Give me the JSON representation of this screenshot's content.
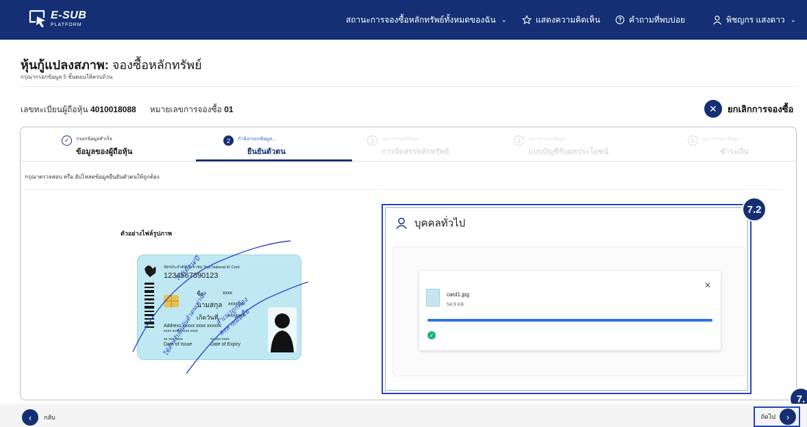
{
  "header": {
    "logo_title": "E-SUB",
    "logo_subtitle": "PLATFORM",
    "nav": {
      "status_all": "สถานะการจองซื้อหลักทรัพย์ทั้งหมดของฉัน",
      "feedback": "แสดงความคิดเห็น",
      "faq": "คำถามที่พบบ่อย",
      "user_name": "พิชญกร แสงดาว"
    }
  },
  "page": {
    "title_bold": "หุ้นกู้แปลงสภาพ:",
    "title_rest": " จองซื้อหลักทรัพย์",
    "subtitle": "กรุณากรอกข้อมูล 5 ขั้นตอนให้ครบถ้วน",
    "reg_label": "เลขทะเบียนผู้ถือหุ้น",
    "reg_value": "4010018088",
    "order_label": "หมายเลขการจองซื้อ",
    "order_value": "01",
    "cancel_label": "ยกเลิกการจองซื้อ"
  },
  "steps": [
    {
      "num": "",
      "small": "กรอกข้อมูลสำเร็จ",
      "big": "ข้อมูลของผู้ถือหุ้น",
      "state": "done"
    },
    {
      "num": "2",
      "small": "กำลังกรอกข้อมูล...",
      "big": "ยืนยันตัวตน",
      "state": "active"
    },
    {
      "num": "3",
      "small": "รอการกรอกข้อมูล",
      "big": "การจัดสรรหลักทรัพย์",
      "state": "future"
    },
    {
      "num": "4",
      "small": "รอการกรอกข้อมูล",
      "big": "แบบบัญชีรับผลประโยชน์",
      "state": "future"
    },
    {
      "num": "5",
      "small": "รอการกรอกข้อมูล",
      "big": "ชำระเงิน",
      "state": "future"
    }
  ],
  "instruction": "กรุณาตรวจสอบ หรือ อัปโหลดข้อมูลยืนยันตัวตนให้ถูกต้อง",
  "sample": {
    "title": "ตัวอย่างไฟล์รูปภาพ",
    "card_header": "บัตรประจำตัวประชาชน Thai National ID Card",
    "id_number": "1234567890123",
    "name_label": "ชื่อ",
    "name_value": "xxxx",
    "surname_label": "นามสกุล",
    "surname_value": "xxxxxxx",
    "dob_label": "เกิดวันที่",
    "dob_value": "xxxxxxx",
    "address_label": "Address",
    "address_value": "xxxxx xxxx xxxxxx",
    "address_line2": "xxxx xxxxxxxxx xxxx",
    "issue_value": "xx xxx xxxx",
    "issue_label": "Date of Issue",
    "expiry_value": "xx xxx xxxx",
    "expiry_label": "Date of Expiry",
    "annotation_1": "วัน/เดือน/ปี",
    "annotation_2": "สำเนาถูกต้อง",
    "annotation_3": "ลงลายมือชื่อ",
    "annotation_4": "ใช้สำหรับยืนยันตัวตนเท่านั้น"
  },
  "upload": {
    "panel_title": "บุคคลทั่วไป",
    "file_name": "card1.jpg",
    "file_size": "54.9 KB",
    "progress": 1.0,
    "close_glyph": "✕",
    "check_glyph": "✓"
  },
  "badges": {
    "panel_badge": "7.2",
    "next_badge": "7."
  },
  "footer": {
    "back_label": "กลับ",
    "next_label": "ถัดไป"
  },
  "colors": {
    "primary": "#142f73",
    "accent_blue": "#2e73e6",
    "success": "#1fb27a"
  }
}
